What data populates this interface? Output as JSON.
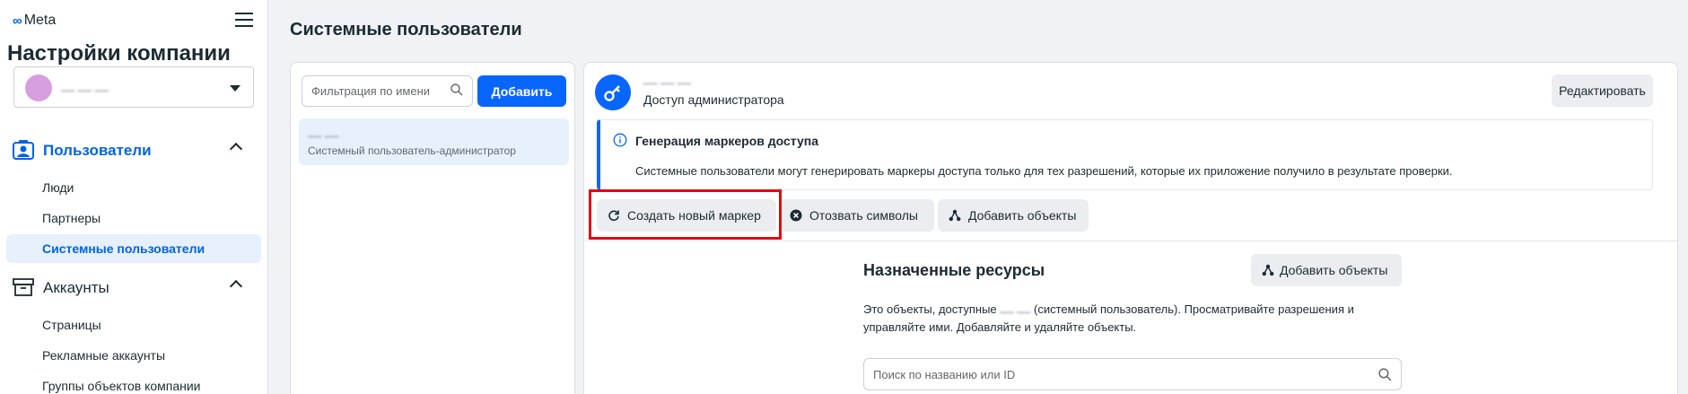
{
  "sidebar": {
    "logo_text": "Meta",
    "title": "Настройки компании",
    "account": {
      "name": "ــــ ــــ ــــ"
    },
    "sections": [
      {
        "label": "Пользователи",
        "items": [
          {
            "label": "Люди",
            "active": false
          },
          {
            "label": "Партнеры",
            "active": false
          },
          {
            "label": "Системные пользователи",
            "active": true
          }
        ]
      },
      {
        "label": "Аккаунты",
        "items": [
          {
            "label": "Страницы",
            "active": false
          },
          {
            "label": "Рекламные аккаунты",
            "active": false
          },
          {
            "label": "Группы объектов компании",
            "active": false
          }
        ]
      }
    ]
  },
  "main": {
    "page_title": "Системные пользователи",
    "list": {
      "filter_placeholder": "Фильтрация по имени",
      "add_label": "Добавить",
      "users": [
        {
          "name": "ــــ ــــ",
          "role": "Системный пользователь-администратор"
        }
      ]
    },
    "detail": {
      "name": "ــــ ــــ ــــ",
      "access": "Доступ администратора",
      "edit_label": "Редактировать",
      "info": {
        "title": "Генерация маркеров доступа",
        "text": "Системные пользователи могут генерировать маркеры доступа только для тех разрешений, которые их приложение получило в результате проверки."
      },
      "actions": {
        "create_token": "Создать новый маркер",
        "revoke": "Отозвать символы",
        "add_objects": "Добавить объекты"
      },
      "resources": {
        "title": "Назначенные ресурсы",
        "add_objects": "Добавить объекты",
        "desc_prefix": "Это объекты, доступные",
        "desc_name": "ــــ ــــ",
        "desc_suffix": "(системный пользователь). Просматривайте разрешения и управляйте ими. Добавляйте и удаляйте объекты.",
        "search_placeholder": "Поиск по названию или ID"
      }
    }
  },
  "colors": {
    "accent": "#0866ff",
    "active_bg": "#e7f0fd",
    "highlight": "#e30613"
  },
  "icons": [
    "meta-logo-icon",
    "hamburger-icon",
    "chevron-down-icon",
    "users-icon",
    "chevron-up-icon",
    "briefcase-icon",
    "search-icon",
    "key-icon",
    "info-icon",
    "refresh-icon",
    "x-circle-icon",
    "add-objects-icon"
  ]
}
